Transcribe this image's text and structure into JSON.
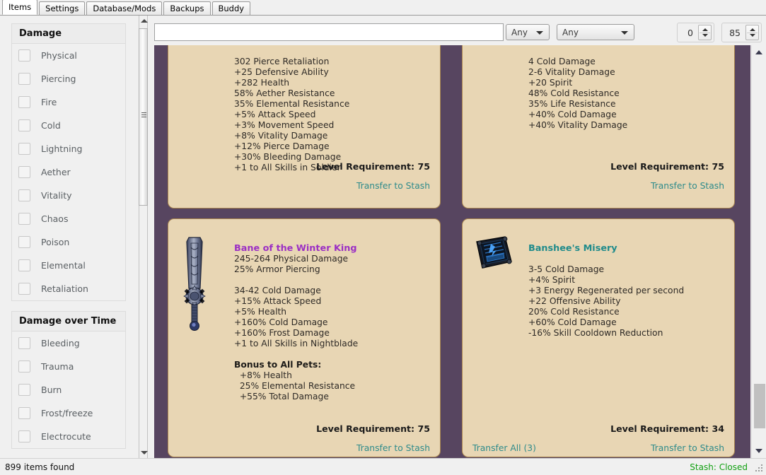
{
  "tabs": [
    {
      "label": "Items",
      "active": true
    },
    {
      "label": "Settings",
      "active": false
    },
    {
      "label": "Database/Mods",
      "active": false
    },
    {
      "label": "Backups",
      "active": false
    },
    {
      "label": "Buddy",
      "active": false
    }
  ],
  "sidebar": {
    "groups": [
      {
        "title": "Damage",
        "items": [
          {
            "label": "Physical",
            "checked": false
          },
          {
            "label": "Piercing",
            "checked": false
          },
          {
            "label": "Fire",
            "checked": false
          },
          {
            "label": "Cold",
            "checked": false
          },
          {
            "label": "Lightning",
            "checked": false
          },
          {
            "label": "Aether",
            "checked": false
          },
          {
            "label": "Vitality",
            "checked": false
          },
          {
            "label": "Chaos",
            "checked": false
          },
          {
            "label": "Poison",
            "checked": false
          },
          {
            "label": "Elemental",
            "checked": false
          },
          {
            "label": "Retaliation",
            "checked": false
          }
        ]
      },
      {
        "title": "Damage over Time",
        "items": [
          {
            "label": "Bleeding",
            "checked": false
          },
          {
            "label": "Trauma",
            "checked": false
          },
          {
            "label": "Burn",
            "checked": false
          },
          {
            "label": "Frost/freeze",
            "checked": false
          },
          {
            "label": "Electrocute",
            "checked": false
          }
        ]
      }
    ]
  },
  "toolbar": {
    "search_value": "",
    "search_placeholder": "",
    "combo1_value": "Any",
    "combo2_value": "Any",
    "spin1_value": "0",
    "spin2_value": "85"
  },
  "cards": [
    {
      "id": "card-tl",
      "name": "",
      "name_class": "",
      "icon": "none",
      "stats": [
        "302 Pierce Retaliation",
        "+25 Defensive Ability",
        "+282 Health",
        "58% Aether Resistance",
        "35% Elemental Resistance",
        "+5% Attack Speed",
        "+3% Movement Speed",
        "+8% Vitality Damage",
        "+12% Pierce Damage",
        "+30% Bleeding Damage",
        "+1 to All Skills in Soldier"
      ],
      "level_requirement": "Level Requirement: 75",
      "transfer_to_stash": "Transfer to Stash",
      "transfer_all": ""
    },
    {
      "id": "card-tr",
      "name": "",
      "name_class": "",
      "icon": "none",
      "stats": [
        "4 Cold Damage",
        "2-6 Vitality Damage",
        "+20 Spirit",
        "48% Cold Resistance",
        "35% Life Resistance",
        "+40% Cold Damage",
        "+40% Vitality Damage"
      ],
      "level_requirement": "Level Requirement: 75",
      "transfer_to_stash": "Transfer to Stash",
      "transfer_all": ""
    },
    {
      "id": "card-bl",
      "name": "Bane of the Winter King",
      "name_class": "name-epic",
      "icon": "mace-weapon-icon",
      "stats": [
        "245-264 Physical Damage",
        "25% Armor Piercing",
        "",
        "34-42 Cold Damage",
        "+15% Attack Speed",
        "+5% Health",
        "+160% Cold Damage",
        "+160% Frost Damage",
        "+1 to All Skills in Nightblade",
        "",
        "Bonus to All Pets:",
        "  +8% Health",
        "  25% Elemental Resistance",
        "  +55% Total Damage"
      ],
      "level_requirement": "Level Requirement: 75",
      "transfer_to_stash": "Transfer to Stash",
      "transfer_all": ""
    },
    {
      "id": "card-br",
      "name": "Banshee's Misery",
      "name_class": "name-rare",
      "icon": "tome-relic-icon",
      "stats": [
        "",
        "3-5 Cold Damage",
        "+4% Spirit",
        "+3 Energy Regenerated per second",
        "+22 Offensive Ability",
        "20% Cold Resistance",
        "+60% Cold Damage",
        "-16% Skill Cooldown Reduction"
      ],
      "level_requirement": "Level Requirement: 34",
      "transfer_to_stash": "Transfer to Stash",
      "transfer_all": "Transfer All (3)"
    }
  ],
  "statusbar": {
    "left": "899 items found",
    "right": "Stash: Closed"
  },
  "colors": {
    "panel_background": "#574560",
    "card_background": "#e8d6b4",
    "card_border": "#a8854f",
    "link": "#2e8b8b",
    "epic_name": "#9b2fc4",
    "rare_name": "#1f8b8b",
    "status_ok": "#12a012"
  }
}
